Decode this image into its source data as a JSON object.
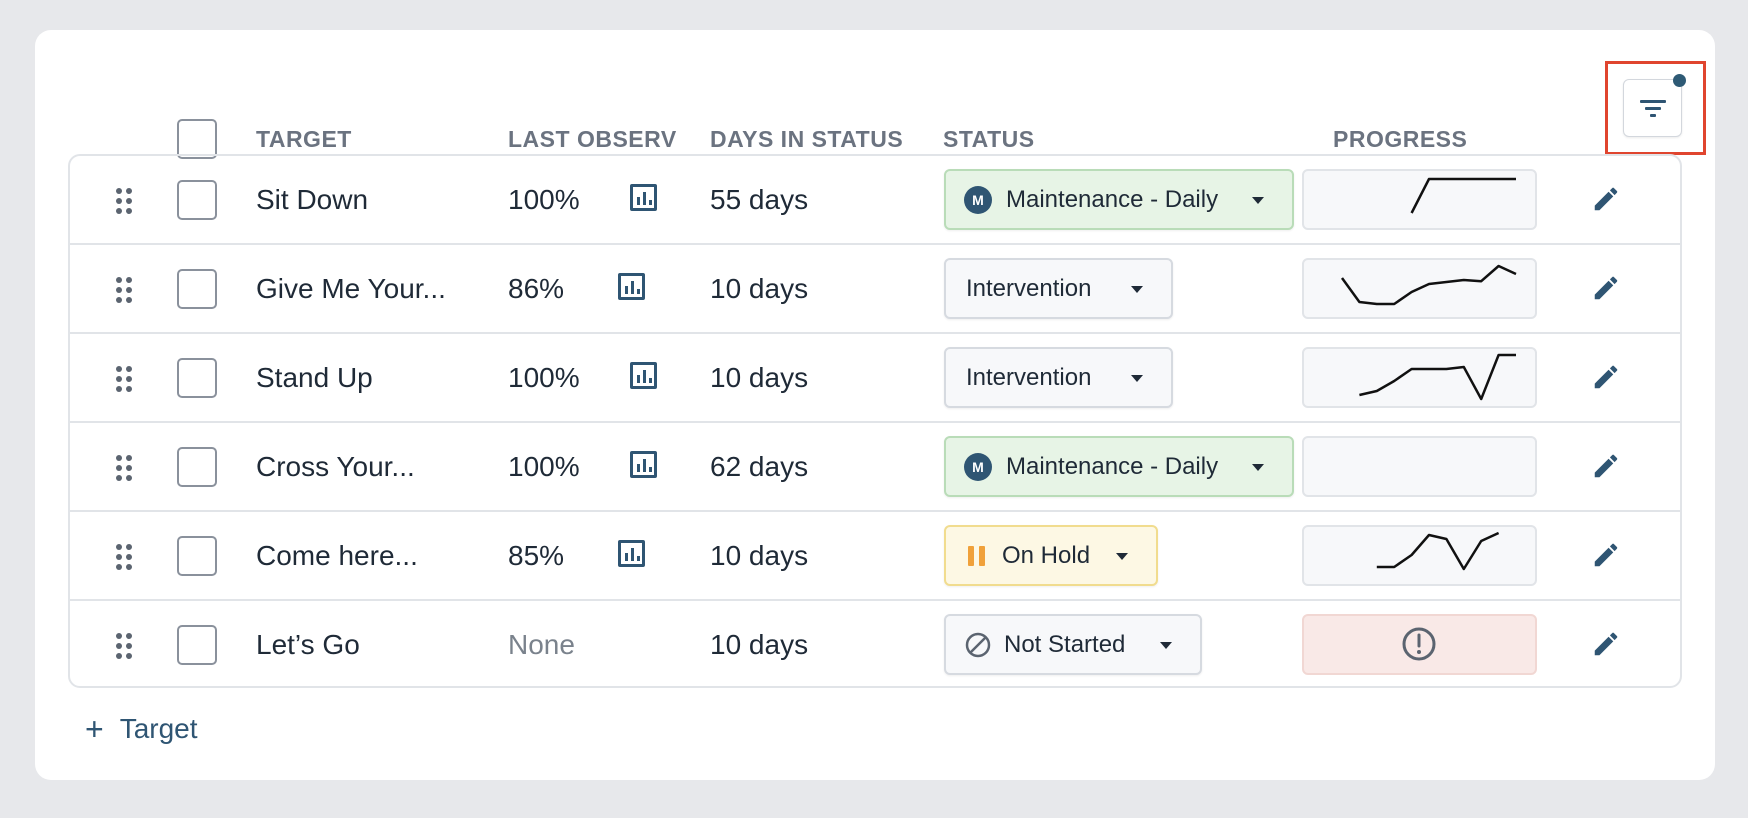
{
  "table": {
    "columns": {
      "target": "TARGET",
      "last_observ": "LAST OBSERV",
      "days_in_status": "DAYS IN STATUS",
      "status": "STATUS",
      "progress": "PROGRESS"
    },
    "filter_icon": "filter-icon",
    "rows": [
      {
        "target": "Sit Down",
        "last_observ": "100%",
        "days": "55 days",
        "status": "Maintenance - Daily",
        "status_type": "maintenance",
        "progress": [
          null,
          null,
          null,
          null,
          0.1,
          0.95,
          0.95,
          0.95,
          0.95,
          0.95,
          0.95
        ]
      },
      {
        "target": "Give Me Your...",
        "last_observ": "86%",
        "days": "10 days",
        "status": "Intervention",
        "status_type": "intervention",
        "progress": [
          0.7,
          0.1,
          0.05,
          0.05,
          0.35,
          0.55,
          0.6,
          0.65,
          0.62,
          1.0,
          0.8
        ]
      },
      {
        "target": "Stand Up",
        "last_observ": "100%",
        "days": "10 days",
        "status": "Intervention",
        "status_type": "intervention",
        "progress": [
          null,
          0.0,
          0.1,
          0.35,
          0.65,
          0.65,
          0.65,
          0.7,
          -0.1,
          1.0,
          1.0
        ]
      },
      {
        "target": "Cross Your...",
        "last_observ": "100%",
        "days": "62 days",
        "status": "Maintenance - Daily",
        "status_type": "maintenance",
        "progress": []
      },
      {
        "target": "Come here...",
        "last_observ": "85%",
        "days": "10 days",
        "status": "On Hold",
        "status_type": "hold",
        "progress": [
          null,
          null,
          0.15,
          0.15,
          0.45,
          0.95,
          0.85,
          0.1,
          0.8,
          1.0
        ]
      },
      {
        "target": "Let’s Go",
        "last_observ": "None",
        "days": "10 days",
        "status": "Not Started",
        "status_type": "not-started",
        "progress": "alert"
      }
    ]
  },
  "add_target_label": "Target",
  "colors": {
    "accent": "#2f5573",
    "maintenance_bg": "#e7f4e6",
    "hold_bg": "#fdf8e4",
    "alert_bg": "#f9e9e7",
    "highlight": "#e0452f"
  }
}
